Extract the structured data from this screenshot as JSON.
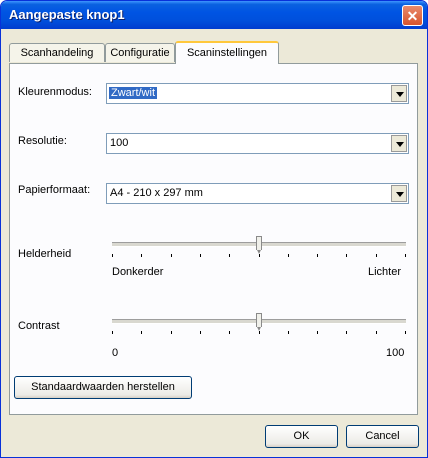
{
  "window": {
    "title": "Aangepaste knop1",
    "close_symbol": "✕"
  },
  "tabs": [
    {
      "label": "Scanhandeling",
      "active": false
    },
    {
      "label": "Configuratie",
      "active": false
    },
    {
      "label": "Scaninstellingen",
      "active": true
    }
  ],
  "settings": {
    "color_mode": {
      "label": "Kleurenmodus:",
      "value": "Zwart/wit"
    },
    "resolution": {
      "label": "Resolutie:",
      "value": "100"
    },
    "paper_size": {
      "label": "Papierformaat:",
      "value": "A4 - 210 x 297 mm"
    },
    "brightness": {
      "label": "Helderheid",
      "min_label": "Donkerder",
      "max_label": "Lichter",
      "level": 0.5
    },
    "contrast": {
      "label": "Contrast",
      "min_label": "0",
      "max_label": "100",
      "level": 0.5
    }
  },
  "buttons": {
    "restore_defaults": "Standaardwaarden herstellen",
    "ok": "OK",
    "cancel": "Cancel"
  },
  "colors": {
    "titlebar": "#0054e3",
    "selection": "#316ac5",
    "dialog_bg": "#ece9d8"
  },
  "icons": {
    "close": "close-icon",
    "dropdown": "chevron-down-icon"
  }
}
